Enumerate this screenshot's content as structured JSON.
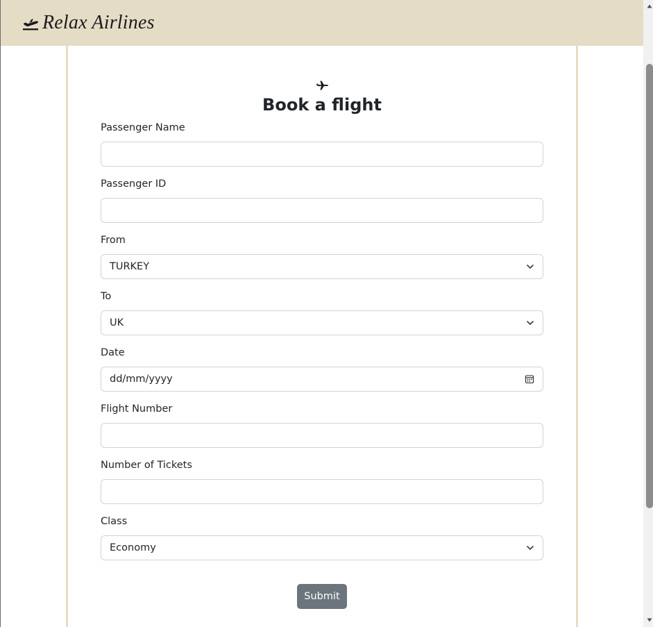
{
  "brand": {
    "name": "Relax Airlines",
    "icon": "plane-departure-icon",
    "bar_color": "#e5dcc5"
  },
  "form": {
    "icon": "plane-icon",
    "title": "Book a flight",
    "fields": {
      "passenger_name": {
        "label": "Passenger Name",
        "value": ""
      },
      "passenger_id": {
        "label": "Passenger ID",
        "value": ""
      },
      "from": {
        "label": "From",
        "value": "TURKEY"
      },
      "to": {
        "label": "To",
        "value": "UK"
      },
      "date": {
        "label": "Date",
        "value": "dd/mm/yyyy"
      },
      "flight_number": {
        "label": "Flight Number",
        "value": ""
      },
      "num_tickets": {
        "label": "Number of Tickets",
        "value": ""
      },
      "class": {
        "label": "Class",
        "value": "Economy"
      }
    },
    "submit_label": "Submit",
    "submit_color": "#6c757d"
  }
}
